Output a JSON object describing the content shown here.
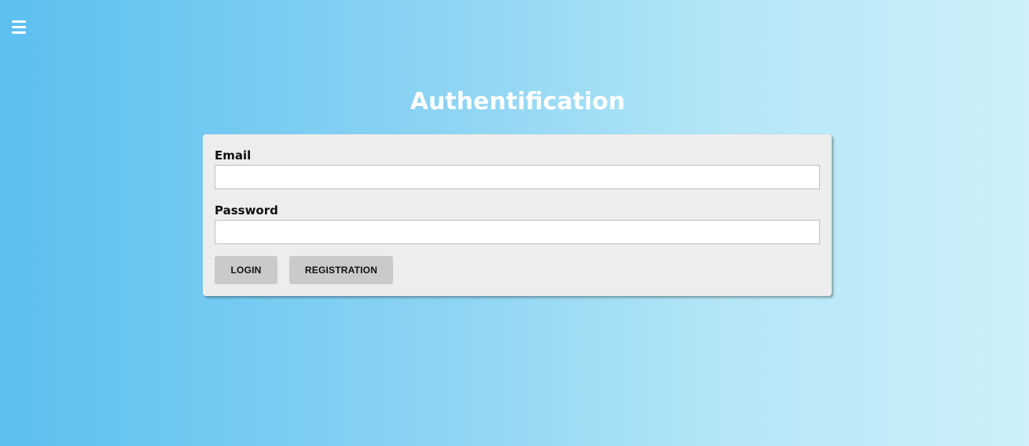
{
  "header": {
    "menu_icon": "hamburger-menu-icon"
  },
  "main": {
    "title": "Authentification"
  },
  "form": {
    "email_label": "Email",
    "email_value": "",
    "email_placeholder": "",
    "password_label": "Password",
    "password_value": "",
    "password_placeholder": "",
    "login_label": "LOGIN",
    "registration_label": "REGISTRATION"
  },
  "colors": {
    "background_start": "#5bbff0",
    "background_end": "#cdf0f9",
    "card_background": "#ededed",
    "button_background": "#cacaca",
    "title_color": "#ffffff"
  }
}
